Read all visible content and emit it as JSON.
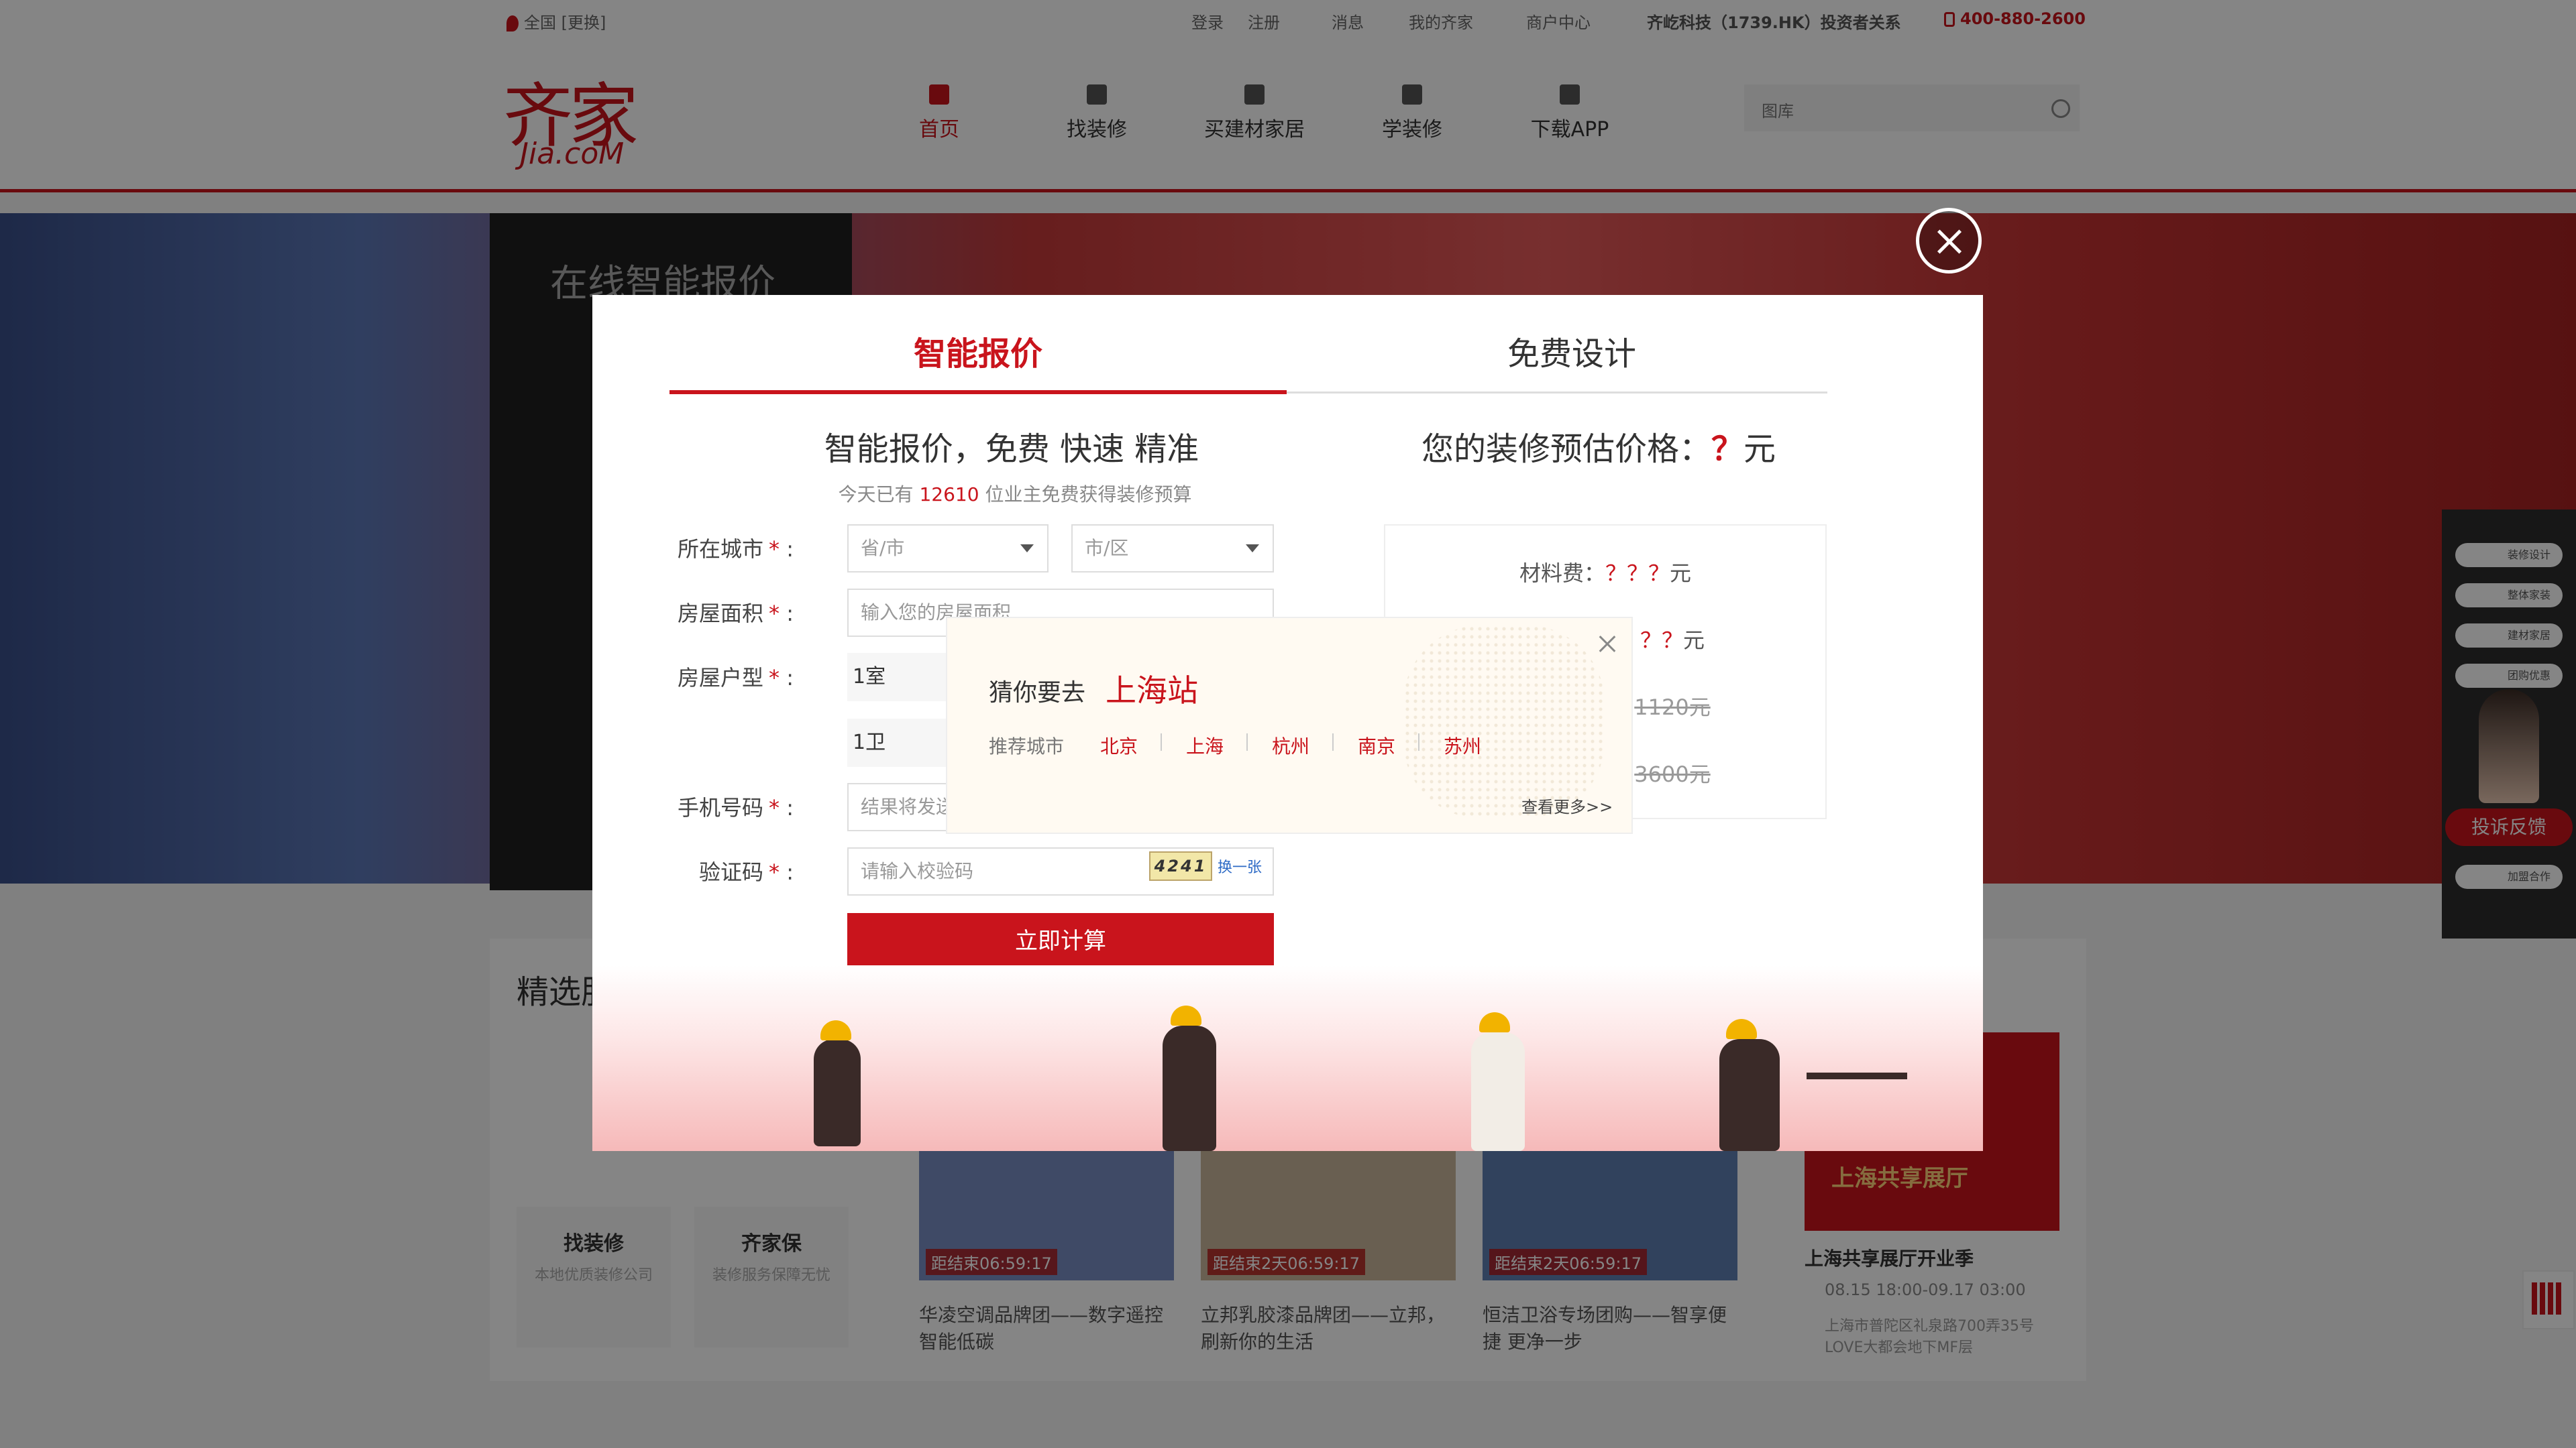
{
  "topbar": {
    "location": "全国 [更换]",
    "links": [
      "登录",
      "注册",
      "消息",
      "我的齐家",
      "商户中心"
    ],
    "investor": "齐屹科技（1739.HK）投资者关系",
    "phone": "400-880-2600"
  },
  "logo": {
    "cn": "齐家",
    "en": "Jia.coM"
  },
  "nav": [
    "首页",
    "找装修",
    "买建材家居",
    "学装修",
    "下载APP"
  ],
  "search": {
    "dropdown": "图库"
  },
  "hero": {
    "quote_title": "在线智能报价"
  },
  "lower": {
    "section_title": "精选服务",
    "cards": [
      {
        "title": "找装修",
        "sub": "本地优质装修公司"
      },
      {
        "title": "齐家保",
        "sub": "装修服务保障无忧"
      }
    ],
    "products": [
      {
        "timer": "距结束06:59:17",
        "desc": "华凌空调品牌团——数字遥控智能低碳"
      },
      {
        "timer": "距结束2天06:59:17",
        "desc": "立邦乳胶漆品牌团——立邦，刷新你的生活"
      },
      {
        "timer": "距结束2天06:59:17",
        "desc": "恒洁卫浴专场团购——智享便捷 更净一步"
      }
    ],
    "event": {
      "title": "上海共享展厅开业季",
      "time": "08.15 18:00-09.17 03:00",
      "addr": "上海市普陀区礼泉路700弄35号LOVE大都会地下MF层",
      "banner": "上海共享展厅"
    }
  },
  "sidebar": {
    "items": [
      "装修设计",
      "整体家装",
      "建材家居",
      "团购优惠",
      "加盟合作"
    ],
    "feedback": "投诉反馈"
  },
  "modal": {
    "tabs": [
      "智能报价",
      "免费设计"
    ],
    "left_title": "智能报价，免费 快速 精准",
    "sub_prefix": "今天已有",
    "count": "12610",
    "sub_suffix": "位业主免费获得装修预算",
    "labels": {
      "city": "所在城市",
      "area": "房屋面积",
      "type": "房屋户型",
      "phone": "手机号码",
      "code": "验证码"
    },
    "required_mark": "*",
    "colon": ":",
    "province_ph": "省/市",
    "city_ph": "市/区",
    "area_ph": "输入您的房屋面积",
    "room": "1室",
    "bath": "1卫",
    "phone_ph": "结果将发送到您的手机",
    "code_ph": "请输入校验码",
    "captcha": "4241",
    "captcha_refresh": "换一张",
    "calc_button": "立即计算",
    "right_title_prefix": "您的装修预估价格：",
    "right_title_q": "？",
    "right_title_unit": "元",
    "material": {
      "label": "材料费：",
      "q": "？？？",
      "unit": "元"
    },
    "labor": {
      "q": "？？",
      "unit": "元"
    },
    "price3": "1120元",
    "price4": "3600元"
  },
  "city_popup": {
    "guess": "猜你要去",
    "station": "上海站",
    "rec_label": "推荐城市",
    "cities": [
      "北京",
      "上海",
      "杭州",
      "南京",
      "苏州"
    ],
    "more": "查看更多>>"
  }
}
